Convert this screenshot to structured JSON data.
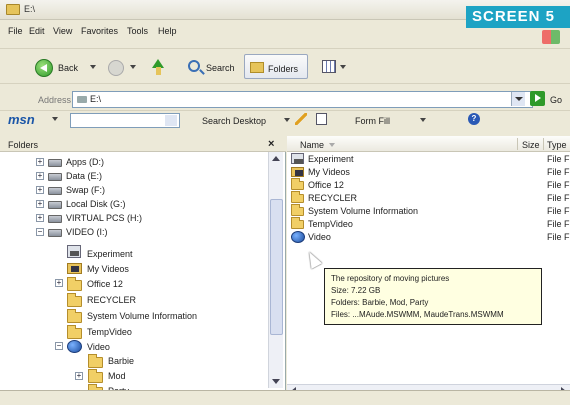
{
  "window": {
    "title": "E:\\",
    "badge": "SCREEN 5"
  },
  "menu": [
    "File",
    "Edit",
    "View",
    "Favorites",
    "Tools",
    "Help"
  ],
  "toolbar": {
    "back": "Back",
    "search": "Search",
    "folders": "Folders"
  },
  "address": {
    "label": "Address",
    "value": "E:\\",
    "go": "Go"
  },
  "msnbar": {
    "logo": "msn",
    "search_desktop": "Search Desktop",
    "form_fill": "Form Fill"
  },
  "folders_pane": {
    "title": "Folders",
    "close": "×",
    "items": [
      {
        "label": "Apps (D:)",
        "expander": "+"
      },
      {
        "label": "Data (E:)",
        "expander": "+"
      },
      {
        "label": "Swap (F:)",
        "expander": "+"
      },
      {
        "label": "Local Disk (G:)",
        "expander": "+"
      },
      {
        "label": "VIRTUAL PCS (H:)",
        "expander": "+"
      },
      {
        "label": "VIDEO (I:)",
        "expander": "−"
      },
      {
        "label": "Experiment"
      },
      {
        "label": "My Videos"
      },
      {
        "label": "Office 12",
        "expander": "+"
      },
      {
        "label": "RECYCLER"
      },
      {
        "label": "System Volume Information"
      },
      {
        "label": "TempVideo"
      },
      {
        "label": "Video",
        "expander": "−"
      },
      {
        "label": "Barbie"
      },
      {
        "label": "Mod",
        "expander": "+"
      },
      {
        "label": "Party"
      }
    ]
  },
  "files_pane": {
    "columns": {
      "name": "Name",
      "size": "Size",
      "type": "Type"
    },
    "rows": [
      {
        "name": "Experiment",
        "type": "File F"
      },
      {
        "name": "My Videos",
        "type": "File F"
      },
      {
        "name": "Office 12",
        "type": "File F"
      },
      {
        "name": "RECYCLER",
        "type": "File F"
      },
      {
        "name": "System Volume Information",
        "type": "File F"
      },
      {
        "name": "TempVideo",
        "type": "File F"
      },
      {
        "name": "Video",
        "type": "File F"
      }
    ]
  },
  "tooltip": {
    "line1": "The repository of moving pictures",
    "line2": "Size: 7.22 GB",
    "line3": "Folders: Barbie, Mod, Party",
    "line4": "Files: ...MAude.MSWMM, MaudeTrans.MSWMM"
  }
}
